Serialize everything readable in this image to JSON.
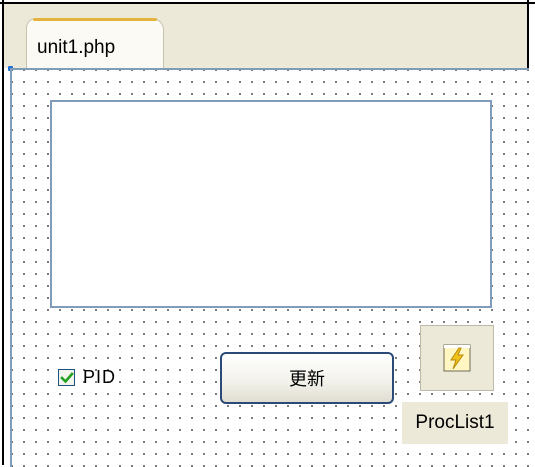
{
  "tabs": [
    {
      "label": "unit1.php",
      "active": true
    }
  ],
  "designer": {
    "memo": {
      "text": ""
    },
    "checkbox": {
      "label": "PID",
      "checked": true
    },
    "update_button": {
      "label": "更新"
    },
    "component": {
      "name": "ProcList1",
      "icon": "lightning-bolt-icon"
    }
  },
  "colors": {
    "tab_accent": "#e6b23e",
    "memo_border": "#7f9db9",
    "button_border": "#2b4a78",
    "checkmark": "#21a121",
    "component_bg": "#ece9d8"
  }
}
